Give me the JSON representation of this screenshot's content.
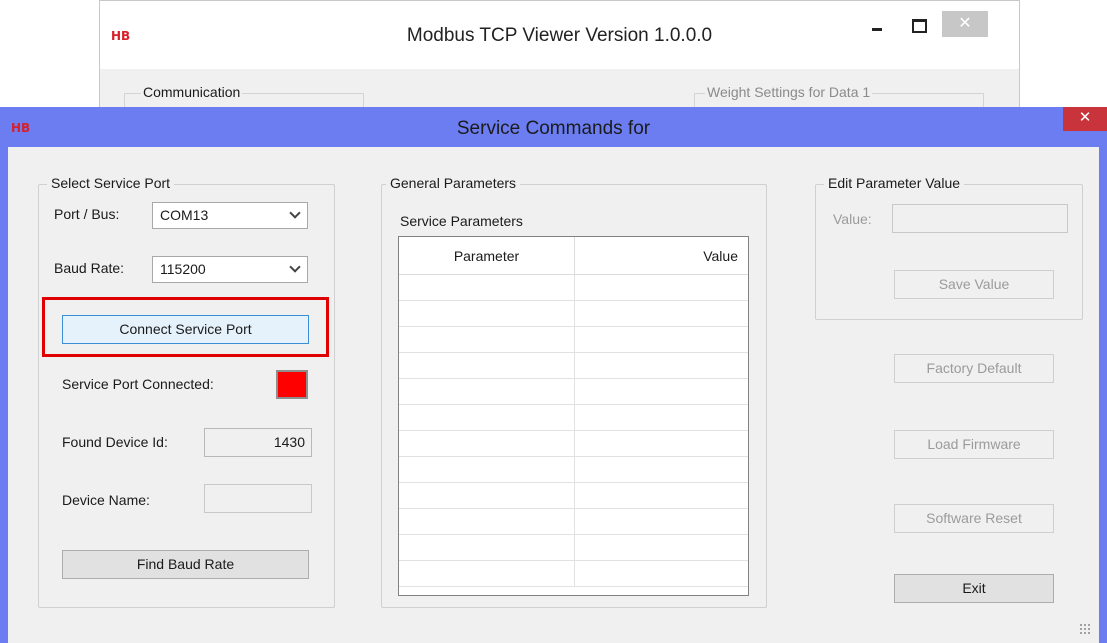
{
  "background_window": {
    "logo": "HB",
    "title": "Modbus TCP Viewer Version 1.0.0.0",
    "close_glyph": "✕",
    "communication_group": "Communication",
    "weight_group": "Weight Settings for Data 1"
  },
  "dialog": {
    "logo": "HB",
    "title": "Service Commands for",
    "close_glyph": "✕"
  },
  "service_port": {
    "group_title": "Select Service Port",
    "port_label": "Port / Bus:",
    "port_value": "COM13",
    "baud_label": "Baud Rate:",
    "baud_value": "115200",
    "connect_button": "Connect Service Port",
    "connected_label": "Service Port Connected:",
    "connected_status_color": "#ff0000",
    "device_id_label": "Found Device Id:",
    "device_id_value": "1430",
    "device_name_label": "Device Name:",
    "device_name_value": "",
    "find_baud_button": "Find Baud Rate"
  },
  "general_parameters": {
    "group_title": "General Parameters",
    "service_parameters_label": "Service Parameters",
    "columns": [
      "Parameter",
      "Value"
    ],
    "rows": []
  },
  "edit_parameter": {
    "group_title": "Edit Parameter Value",
    "value_label": "Value:",
    "value": "",
    "save_button": "Save Value"
  },
  "actions": {
    "factory_default": "Factory Default",
    "load_firmware": "Load Firmware",
    "software_reset": "Software Reset",
    "exit": "Exit"
  },
  "colors": {
    "dialog_titlebar": "#6b7df0",
    "highlight_border": "#e00000",
    "logo": "#d6202a"
  }
}
